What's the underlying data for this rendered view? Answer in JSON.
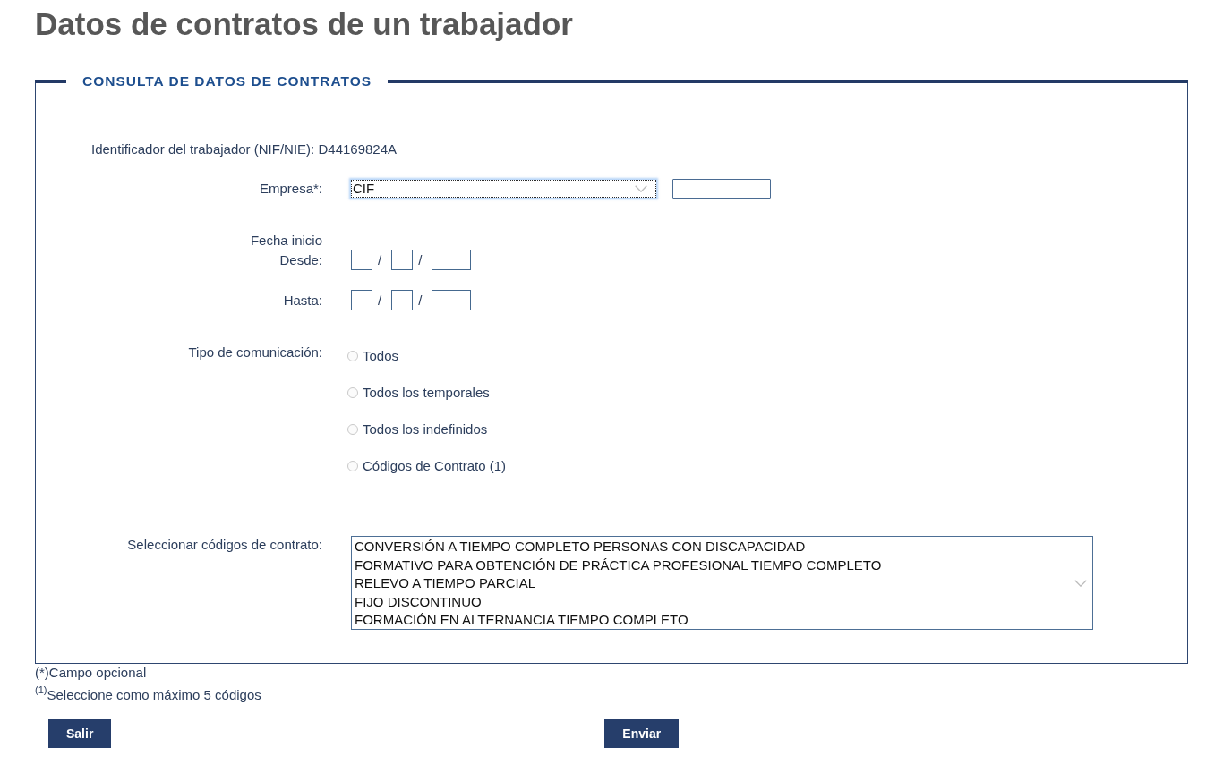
{
  "page_title": "Datos de contratos de un trabajador",
  "form": {
    "legend": "CONSULTA DE DATOS DE CONTRATOS",
    "worker_id": {
      "label": "Identificador del trabajador (NIF/NIE):",
      "value": "D44169824A"
    },
    "company": {
      "label": "Empresa*:",
      "select": {
        "value": "CIF",
        "focused": true
      },
      "code_field": {
        "focused": false
      }
    },
    "start_date": {
      "label": "Fecha inicio",
      "ranges": [
        {
          "label": "Desde:",
          "fields": [
            {
              "kind": "day"
            },
            {
              "kind": "month"
            },
            {
              "kind": "year"
            }
          ],
          "separators": [
            "/",
            "/"
          ]
        },
        {
          "label": "Hasta:",
          "fields": [
            {
              "kind": "day"
            },
            {
              "kind": "month"
            },
            {
              "kind": "year"
            }
          ],
          "separators": [
            "/",
            "/"
          ]
        }
      ]
    },
    "communication_type": {
      "label": "Tipo de comunicación:",
      "options": [
        {
          "label": "Todos",
          "selected": false
        },
        {
          "label": "Todos los temporales",
          "selected": false
        },
        {
          "label": "Todos los indefinidos",
          "selected": false
        },
        {
          "label": "Códigos de Contrato (1)",
          "selected": false
        }
      ]
    },
    "contract_codes": {
      "label": "Seleccionar códigos de contrato:",
      "items": [
        {
          "label": "CONVERSIÓN A TIEMPO COMPLETO PERSONAS CON DISCAPACIDAD",
          "selected": false
        },
        {
          "label": "FORMATIVO PARA OBTENCIÓN DE PRÁCTICA PROFESIONAL TIEMPO COMPLETO",
          "selected": false
        },
        {
          "label": "RELEVO A TIEMPO PARCIAL",
          "selected": false
        },
        {
          "label": "FIJO DISCONTINUO",
          "selected": false
        },
        {
          "label": "FORMACIÓN EN ALTERNANCIA TIEMPO COMPLETO",
          "selected": false
        }
      ]
    }
  },
  "footnotes": [
    "(*)Campo opcional",
    "$^{(1)}$Seleccione como máximo 5 códigos"
  ],
  "buttons": [
    {
      "label": "Salir"
    },
    {
      "label": "Enviar"
    }
  ]
}
